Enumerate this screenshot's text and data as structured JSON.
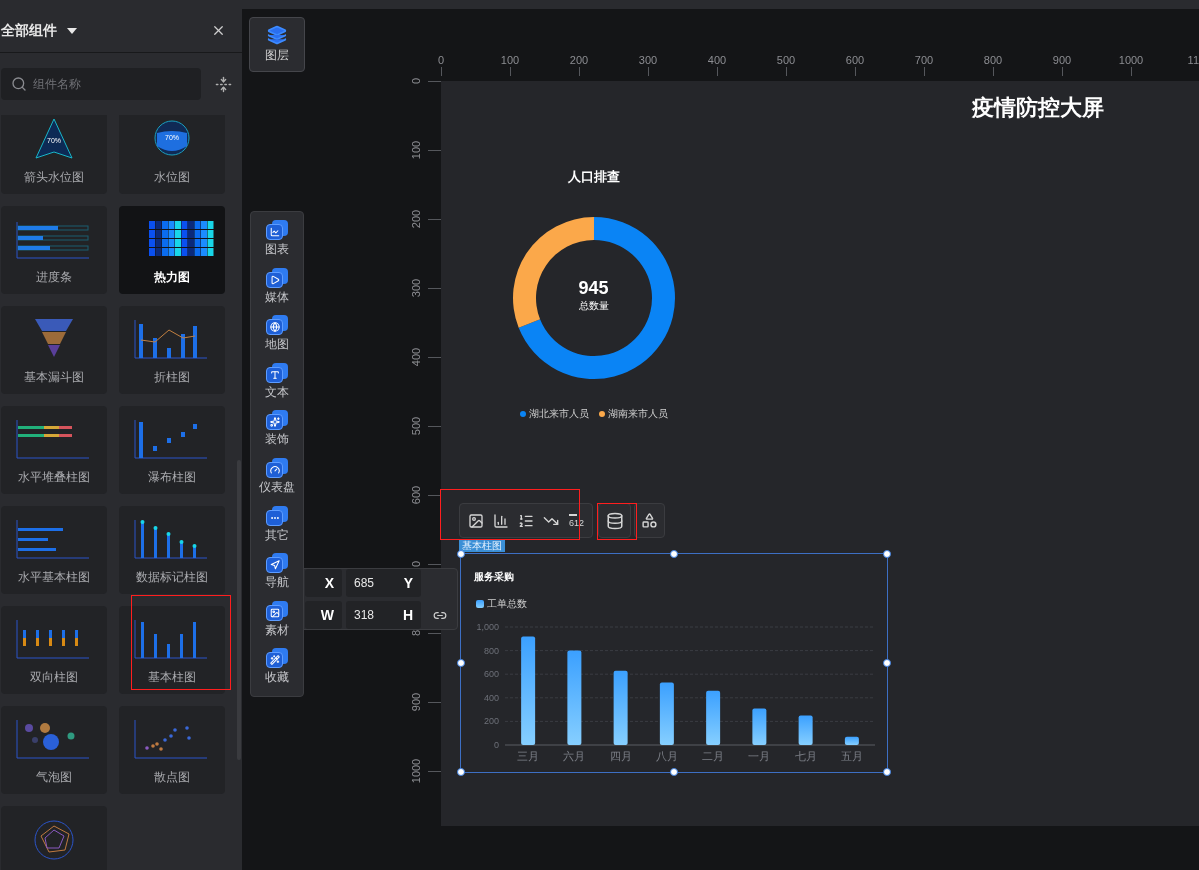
{
  "component_panel": {
    "title": "全部组件",
    "search": {
      "placeholder": "组件名称"
    },
    "cards": [
      {
        "label": "箭头水位图",
        "kind": "arrow-gauge",
        "text": "70%",
        "selected": false,
        "highlighted": false
      },
      {
        "label": "水位图",
        "kind": "water-gauge",
        "text": "70%",
        "selected": false,
        "highlighted": false
      },
      {
        "label": "进度条",
        "kind": "progress",
        "selected": false,
        "highlighted": false
      },
      {
        "label": "热力图",
        "kind": "heatmap",
        "selected": true,
        "highlighted": false
      },
      {
        "label": "基本漏斗图",
        "kind": "funnel",
        "selected": false,
        "highlighted": false
      },
      {
        "label": "折柱图",
        "kind": "line-bar",
        "selected": false,
        "highlighted": false
      },
      {
        "label": "水平堆叠柱图",
        "kind": "h-stacked",
        "selected": false,
        "highlighted": false
      },
      {
        "label": "瀑布柱图",
        "kind": "waterfall",
        "selected": false,
        "highlighted": false
      },
      {
        "label": "水平基本柱图",
        "kind": "h-bar",
        "selected": false,
        "highlighted": false
      },
      {
        "label": "数据标记柱图",
        "kind": "marker-bar",
        "selected": false,
        "highlighted": false
      },
      {
        "label": "双向柱图",
        "kind": "bidirectional",
        "selected": false,
        "highlighted": false
      },
      {
        "label": "基本柱图",
        "kind": "bar",
        "selected": false,
        "highlighted": true
      },
      {
        "label": "气泡图",
        "kind": "bubble",
        "selected": false,
        "highlighted": false
      },
      {
        "label": "散点图",
        "kind": "scatter",
        "selected": false,
        "highlighted": false
      },
      {
        "kind": "radar",
        "selected": false,
        "highlighted": false
      }
    ]
  },
  "layer_button": {
    "label": "图层"
  },
  "categories": [
    {
      "label": "图表",
      "kind": "chart"
    },
    {
      "label": "媒体",
      "kind": "media"
    },
    {
      "label": "地图",
      "kind": "map"
    },
    {
      "label": "文本",
      "kind": "text"
    },
    {
      "label": "装饰",
      "kind": "decoration"
    },
    {
      "label": "仪表盘",
      "kind": "gauge"
    },
    {
      "label": "其它",
      "kind": "other"
    },
    {
      "label": "导航",
      "kind": "navigation"
    },
    {
      "label": "素材",
      "kind": "material"
    },
    {
      "label": "收藏",
      "kind": "favorite"
    }
  ],
  "ruler": {
    "x_ticks": [
      "0",
      "100",
      "200",
      "300",
      "400",
      "500",
      "600",
      "700",
      "800",
      "900",
      "1000",
      "11"
    ],
    "y_ticks": [
      "0",
      "100",
      "200",
      "300",
      "400",
      "500",
      "600",
      "0",
      "8",
      "900",
      "1000"
    ]
  },
  "canvas": {
    "title": "疫情防控大屏",
    "donut_widget": {
      "total": "945",
      "total_label": "总数量",
      "legend": [
        {
          "color": "#0a84f5"
        },
        {
          "color": "#fba84a"
        }
      ],
      "chart_data": {
        "type": "donut",
        "title": "人口排查",
        "categories": [
          "湖北来市人员",
          "湖南来市人员"
        ],
        "values": [
          69,
          31
        ]
      }
    },
    "bar_widget": {
      "tag": "基本柱图",
      "selected": true,
      "chart_data": {
        "type": "bar",
        "title": "服务采购",
        "categories": [
          "三月",
          "六月",
          "四月",
          "八月",
          "二月",
          "一月",
          "七月",
          "五月"
        ],
        "series": [
          {
            "name": "工单总数",
            "color": "#3ba0ff",
            "values": [
              920,
              800,
              630,
              530,
              460,
              310,
              250,
              70
            ]
          }
        ],
        "ylim": [
          0,
          1000
        ],
        "yticks": [
          0,
          200,
          400,
          600,
          800,
          {
            "value": 1000,
            "label": "1,000"
          }
        ],
        "grid": true
      }
    }
  },
  "widget_toolbar": {
    "highlighted": true,
    "tools": [
      {
        "kind": "image"
      },
      {
        "kind": "bars"
      },
      {
        "kind": "list"
      },
      {
        "kind": "axis"
      },
      {
        "kind": "number",
        "text": "612"
      }
    ]
  },
  "data_button": {
    "highlighted": true
  },
  "position_panel": {
    "rows": [
      {
        "label": "X",
        "value": "685",
        "value_label": "Y"
      },
      {
        "label": "W",
        "value": "318",
        "value_label": "H"
      }
    ]
  }
}
